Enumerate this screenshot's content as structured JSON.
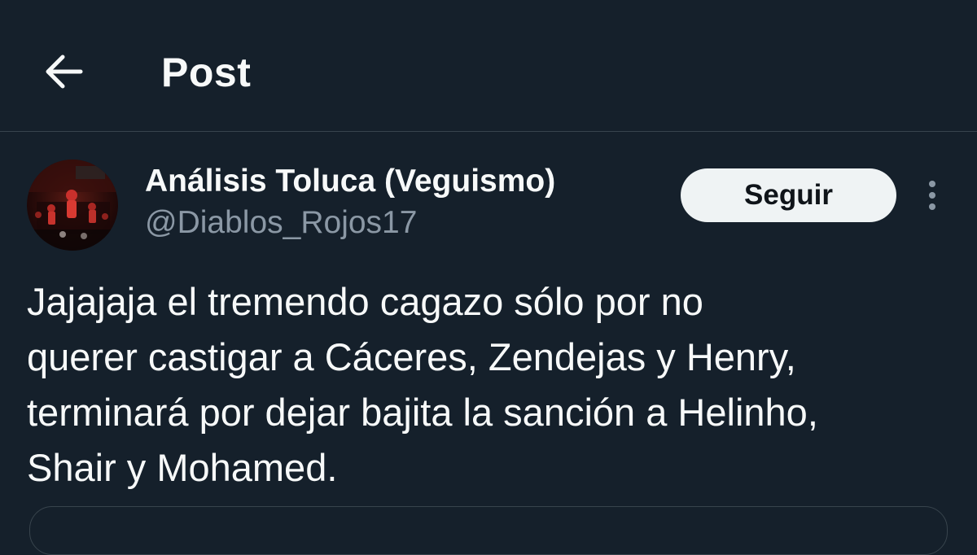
{
  "header": {
    "title": "Post",
    "back_icon": "arrow-left-icon"
  },
  "author": {
    "display_name": "Análisis Toluca (Veguismo)",
    "handle": "@Diablos_Rojos17",
    "avatar_icon": "profile-avatar"
  },
  "actions": {
    "follow_label": "Seguir",
    "more_icon": "more-vertical-icon"
  },
  "post": {
    "lines": [
      "Jajajaja el tremendo cagazo sólo por no",
      "querer castigar a Cáceres, Zendejas y Henry,",
      "terminará por dejar bajita la sanción a Helinho,",
      "Shair y Mohamed."
    ]
  },
  "colors": {
    "background": "#15202b",
    "text_primary": "#f7f9f9",
    "text_secondary": "#8b98a5",
    "divider": "#38444d",
    "follow_button_bg": "#eff3f4",
    "follow_button_text": "#0f1419"
  }
}
